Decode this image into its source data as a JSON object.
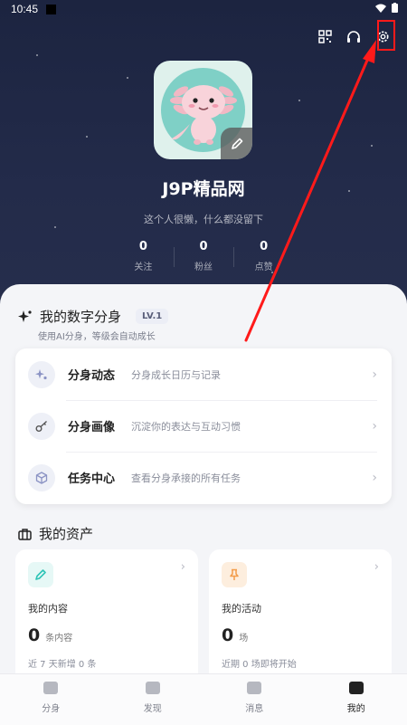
{
  "status": {
    "time": "10:45"
  },
  "header_icons": [
    "qr-code-icon",
    "headset-icon",
    "settings-icon"
  ],
  "profile": {
    "name": "J9P精品网",
    "bio": "这个人很懒，什么都没留下",
    "stats": [
      {
        "value": "0",
        "label": "关注"
      },
      {
        "value": "0",
        "label": "粉丝"
      },
      {
        "value": "0",
        "label": "点赞"
      }
    ]
  },
  "digital_twin": {
    "title": "我的数字分身",
    "level": "LV.1",
    "subtitle": "使用AI分身，等级会自动成长",
    "items": [
      {
        "title": "分身动态",
        "desc": "分身成长日历与记录",
        "icon": "sparkle-icon"
      },
      {
        "title": "分身画像",
        "desc": "沉淀你的表达与互动习惯",
        "icon": "key-icon"
      },
      {
        "title": "任务中心",
        "desc": "查看分身承接的所有任务",
        "icon": "cube-icon"
      }
    ]
  },
  "assets": {
    "title": "我的资产",
    "cards": [
      {
        "title": "我的内容",
        "value": "0",
        "unit": "条内容",
        "note": "近 7 天新增 0 条",
        "icon": "pencil-icon",
        "color": "#2ec4b6"
      },
      {
        "title": "我的活动",
        "value": "0",
        "unit": "场",
        "note": "近期 0 场即将开始",
        "icon": "pin-icon",
        "color": "#f39c4a"
      }
    ]
  },
  "tabs": [
    {
      "label": "分身",
      "active": false
    },
    {
      "label": "发现",
      "active": false
    },
    {
      "label": "消息",
      "active": false
    },
    {
      "label": "我的",
      "active": true
    }
  ],
  "annotation_color": "#ff1a1a"
}
